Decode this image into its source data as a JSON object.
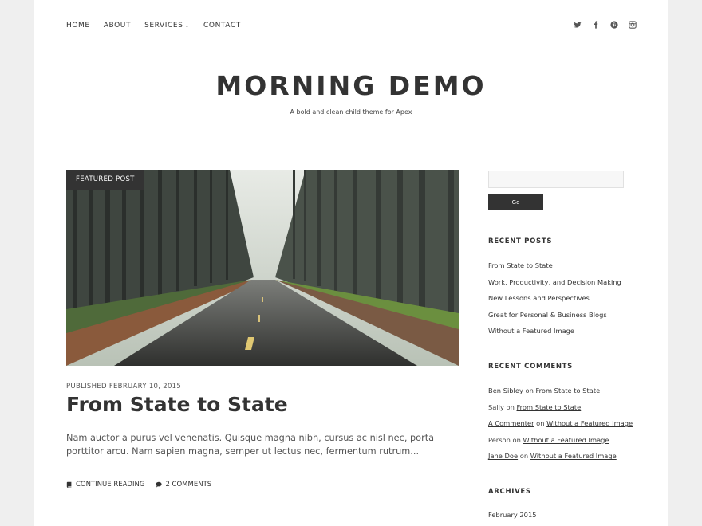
{
  "nav": {
    "items": [
      "HOME",
      "ABOUT",
      "SERVICES",
      "CONTACT"
    ],
    "services_chevron": "chevron-down-icon"
  },
  "social": {
    "icons": [
      "twitter-icon",
      "facebook-icon",
      "pinterest-icon",
      "instagram-icon"
    ]
  },
  "header": {
    "title": "MORNING DEMO",
    "tagline": "A bold and clean child theme for Apex"
  },
  "post": {
    "badge": "FEATURED POST",
    "published": "PUBLISHED FEBRUARY 10, 2015",
    "title": "From State to State",
    "excerpt": "Nam auctor a purus vel venenatis. Quisque magna nibh, cursus ac nisl nec, porta porttitor arcu. Nam sapien magna, semper ut lectus nec, fermentum rutrum...",
    "continue_label": "CONTINUE READING",
    "comments_label": "2 COMMENTS"
  },
  "sidebar": {
    "search_placeholder": "",
    "go_label": "Go",
    "recent_posts_title": "RECENT POSTS",
    "recent_posts": [
      "From State to State",
      "Work, Productivity, and Decision Making",
      "New Lessons and Perspectives",
      "Great for Personal & Business Blogs",
      "Without a Featured Image"
    ],
    "recent_comments_title": "RECENT COMMENTS",
    "recent_comments": [
      {
        "author": "Ben Sibley",
        "author_link": true,
        "on": "on",
        "post": "From State to State"
      },
      {
        "author": "Sally",
        "author_link": false,
        "on": "on",
        "post": "From State to State"
      },
      {
        "author": "A Commenter",
        "author_link": true,
        "on": "on",
        "post": "Without a Featured Image"
      },
      {
        "author": "Person",
        "author_link": false,
        "on": "on",
        "post": "Without a Featured Image"
      },
      {
        "author": "Jane Doe",
        "author_link": true,
        "on": "on",
        "post": "Without a Featured Image"
      }
    ],
    "archives_title": "ARCHIVES",
    "archives": [
      "February 2015"
    ]
  },
  "colors": {
    "background": "#efefef",
    "page": "#ffffff",
    "text": "#333333",
    "button": "#333333"
  }
}
